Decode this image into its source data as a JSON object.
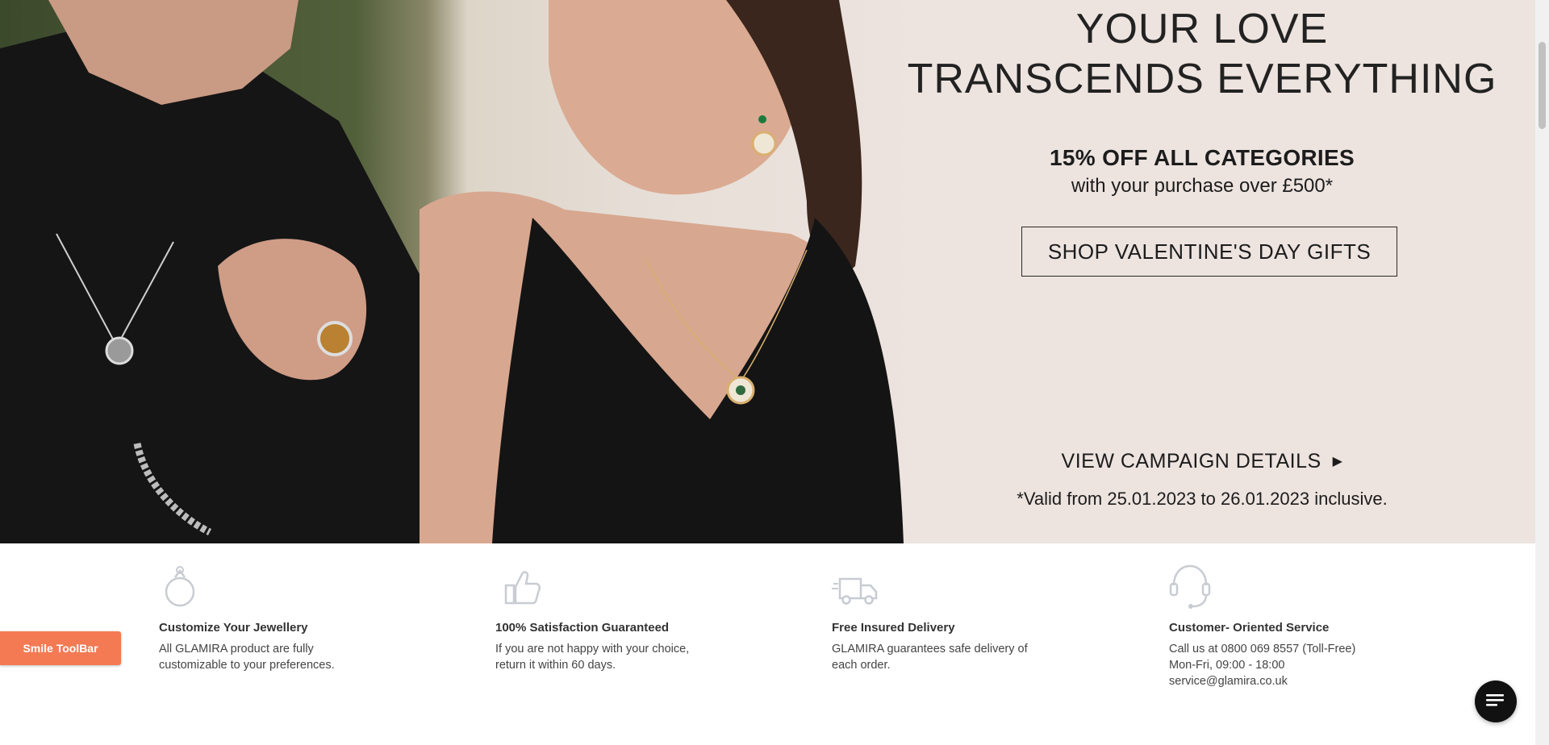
{
  "hero": {
    "headline_line1": "YOUR LOVE",
    "headline_line2": "TRANSCENDS EVERYTHING",
    "offer_main": "15% OFF ALL CATEGORIES",
    "offer_sub": "with your purchase over £500*",
    "cta_label": "SHOP VALENTINE'S DAY GIFTS",
    "campaign_link": "VIEW CAMPAIGN DETAILS",
    "validity": "*Valid from 25.01.2023 to 26.01.2023 inclusive."
  },
  "features": [
    {
      "icon": "ring-icon",
      "title": "Customize Your Jewellery",
      "text": "All GLAMIRA product are fully customizable to your preferences."
    },
    {
      "icon": "thumbs-up-icon",
      "title": "100% Satisfaction Guaranteed",
      "text": "If you are not happy with your choice, return it within 60 days."
    },
    {
      "icon": "delivery-truck-icon",
      "title": "Free Insured Delivery",
      "text": "GLAMIRA guarantees safe delivery of each order."
    },
    {
      "icon": "headset-icon",
      "title": "Customer- Oriented Service",
      "text": "Call us at 0800 069 8557 (Toll-Free) Mon-Fri, 09:00 - 18:00 service@glamira.co.uk"
    }
  ],
  "toolbar": {
    "label": "Smile ToolBar"
  },
  "chat": {
    "icon": "chat-icon"
  },
  "colors": {
    "hero_bg": "#ede3df",
    "toolbar_bg": "#f47a53",
    "chat_bg": "#111111",
    "icon_gray": "#c8ccd2"
  }
}
